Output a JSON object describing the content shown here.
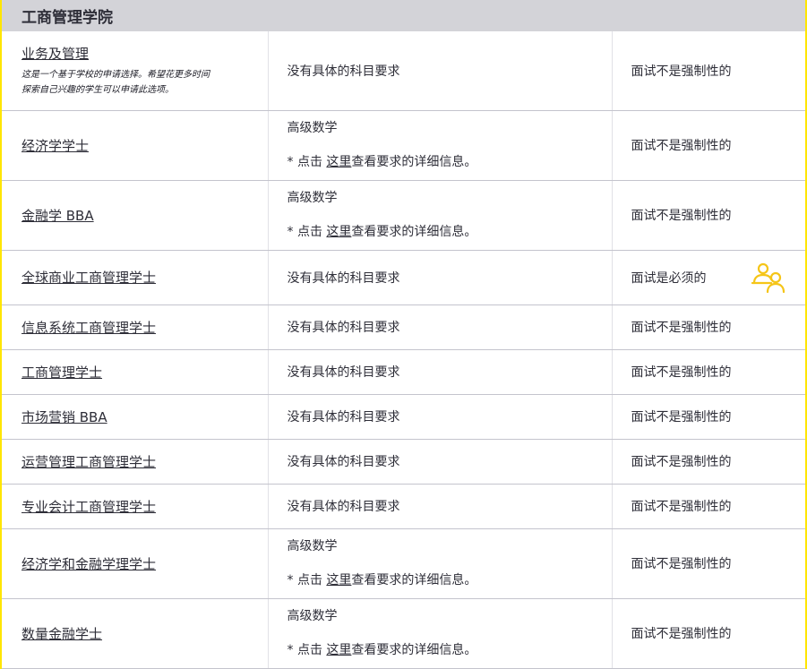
{
  "section": {
    "title": "工商管理学院"
  },
  "rows": [
    {
      "program": "业务及管理",
      "note_line1": "这是一个基于学校的申请选择。希望花更多时间",
      "note_line2": "探索自己兴趣的学生可以申请此选项。",
      "requirement": "没有具体的科目要求",
      "interview": "面试不是强制性的"
    },
    {
      "program": "经济学学士",
      "requirement": "高级数学",
      "detail_prefix": "* 点击 ",
      "detail_link": "这里",
      "detail_suffix": "查看要求的详细信息。",
      "interview": "面试不是强制性的"
    },
    {
      "program": "金融学 BBA",
      "requirement": "高级数学",
      "detail_prefix": "* 点击 ",
      "detail_link": "这里",
      "detail_suffix": "查看要求的详细信息。",
      "interview": "面试不是强制性的"
    },
    {
      "program": "全球商业工商管理学士",
      "requirement": "没有具体的科目要求",
      "interview": "面试是必须的",
      "icon": "interview-people-icon"
    },
    {
      "program": "信息系统工商管理学士",
      "requirement": "没有具体的科目要求",
      "interview": "面试不是强制性的"
    },
    {
      "program": "工商管理学士",
      "requirement": "没有具体的科目要求",
      "interview": "面试不是强制性的"
    },
    {
      "program": "市场营销 BBA",
      "requirement": "没有具体的科目要求",
      "interview": "面试不是强制性的"
    },
    {
      "program": "运营管理工商管理学士",
      "requirement": "没有具体的科目要求",
      "interview": "面试不是强制性的"
    },
    {
      "program": "专业会计工商管理学士",
      "requirement": "没有具体的科目要求",
      "interview": "面试不是强制性的"
    },
    {
      "program": "经济学和金融学理学士",
      "requirement": "高级数学",
      "detail_prefix": "* 点击 ",
      "detail_link": "这里",
      "detail_suffix": "查看要求的详细信息。",
      "interview": "面试不是强制性的"
    },
    {
      "program": "数量金融学士",
      "requirement": "高级数学",
      "detail_prefix": "* 点击 ",
      "detail_link": "这里",
      "detail_suffix": "查看要求的详细信息。",
      "interview": "面试不是强制性的"
    }
  ],
  "colors": {
    "accent": "#ffe600",
    "header_bg": "#d3d3d8",
    "text": "#2e2e38",
    "icon": "#f5c518"
  }
}
